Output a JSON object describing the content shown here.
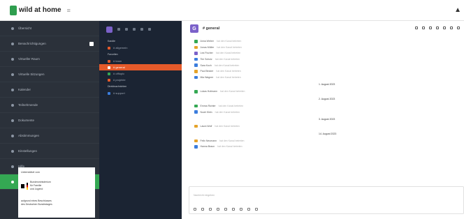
{
  "topbar": {
    "brand": "wild at home",
    "menu_icon": "hamburger-icon",
    "user_icon": "user-icon"
  },
  "left_nav": {
    "items": [
      {
        "label": "Übersicht"
      },
      {
        "label": "Benachrichtigungen"
      },
      {
        "label": "Virtueller Raum"
      },
      {
        "label": "Virtuelle Sitzungen"
      },
      {
        "label": "Kalender"
      },
      {
        "label": "Teilnehmende"
      },
      {
        "label": "Dokumente"
      },
      {
        "label": "Abstimmungen"
      },
      {
        "label": "Einstellungen"
      },
      {
        "label": "Hilfe"
      },
      {
        "label": "Chat"
      }
    ],
    "footer": {
      "title": "Unterstützt von",
      "org_lines": [
        "Bundesministerium",
        "für Familie",
        "und Jugend"
      ],
      "note_lines": [
        "aufgrund eines Beschlusses",
        "des Deutschen Bundestages"
      ]
    }
  },
  "chat_nav": {
    "section_labels": [
      "Kanäle",
      "Favoriten",
      "Direktnachrichten"
    ],
    "channels": [
      {
        "label": "# allgemein",
        "color": "#e55a2a",
        "active": false
      },
      {
        "label": "# team",
        "color": "#e55a2a",
        "active": false
      },
      {
        "label": "# general",
        "color": "#e55a2a",
        "active": true
      },
      {
        "label": "# offtopic",
        "color": "#34a853",
        "active": false
      },
      {
        "label": "# projekte",
        "color": "#e55a2a",
        "active": false
      },
      {
        "label": "# support",
        "color": "#3b7ddd",
        "active": false
      }
    ]
  },
  "chat": {
    "room_letter": "G",
    "room_title": "# general",
    "messages_a": [
      {
        "name": "Anna Weber",
        "text": "hat den Kanal betreten",
        "color": "#34a853"
      },
      {
        "name": "Jonas Müller",
        "text": "hat den Kanal betreten",
        "color": "#e5a32a"
      },
      {
        "name": "Lea Fischer",
        "text": "hat den Kanal betreten",
        "color": "#7b61c9"
      },
      {
        "name": "Tim Schulz",
        "text": "hat den Kanal betreten",
        "color": "#3b7ddd"
      },
      {
        "name": "Sara Koch",
        "text": "hat den Kanal betreten",
        "color": "#3b7ddd"
      },
      {
        "name": "Paul Becker",
        "text": "hat den Kanal betreten",
        "color": "#e5a32a"
      },
      {
        "name": "Mia Wagner",
        "text": "hat den Kanal betreten",
        "color": "#3b7ddd"
      }
    ],
    "date_1": "1. August 2023",
    "msg_b": {
      "name": "Lukas Hofmann",
      "text": "hat den Kanal betreten",
      "color": "#34a853"
    },
    "date_2": "2. August 2023",
    "messages_c": [
      {
        "name": "Emma Richter",
        "text": "hat den Kanal betreten",
        "color": "#34a853"
      },
      {
        "name": "Noah Klein",
        "text": "hat den Kanal betreten",
        "color": "#3b7ddd"
      }
    ],
    "date_3": "3. August 2023",
    "msg_d": {
      "name": "Laura Wolf",
      "text": "hat den Kanal betreten",
      "color": "#e5a32a"
    },
    "date_4": "14. August 2023",
    "messages_e": [
      {
        "name": "Felix Neumann",
        "text": "hat den Kanal betreten",
        "color": "#e5a32a"
      },
      {
        "name": "Hanna Braun",
        "text": "hat den Kanal betreten",
        "color": "#3b7ddd"
      }
    ],
    "composer_placeholder": "Nachricht eingeben"
  }
}
